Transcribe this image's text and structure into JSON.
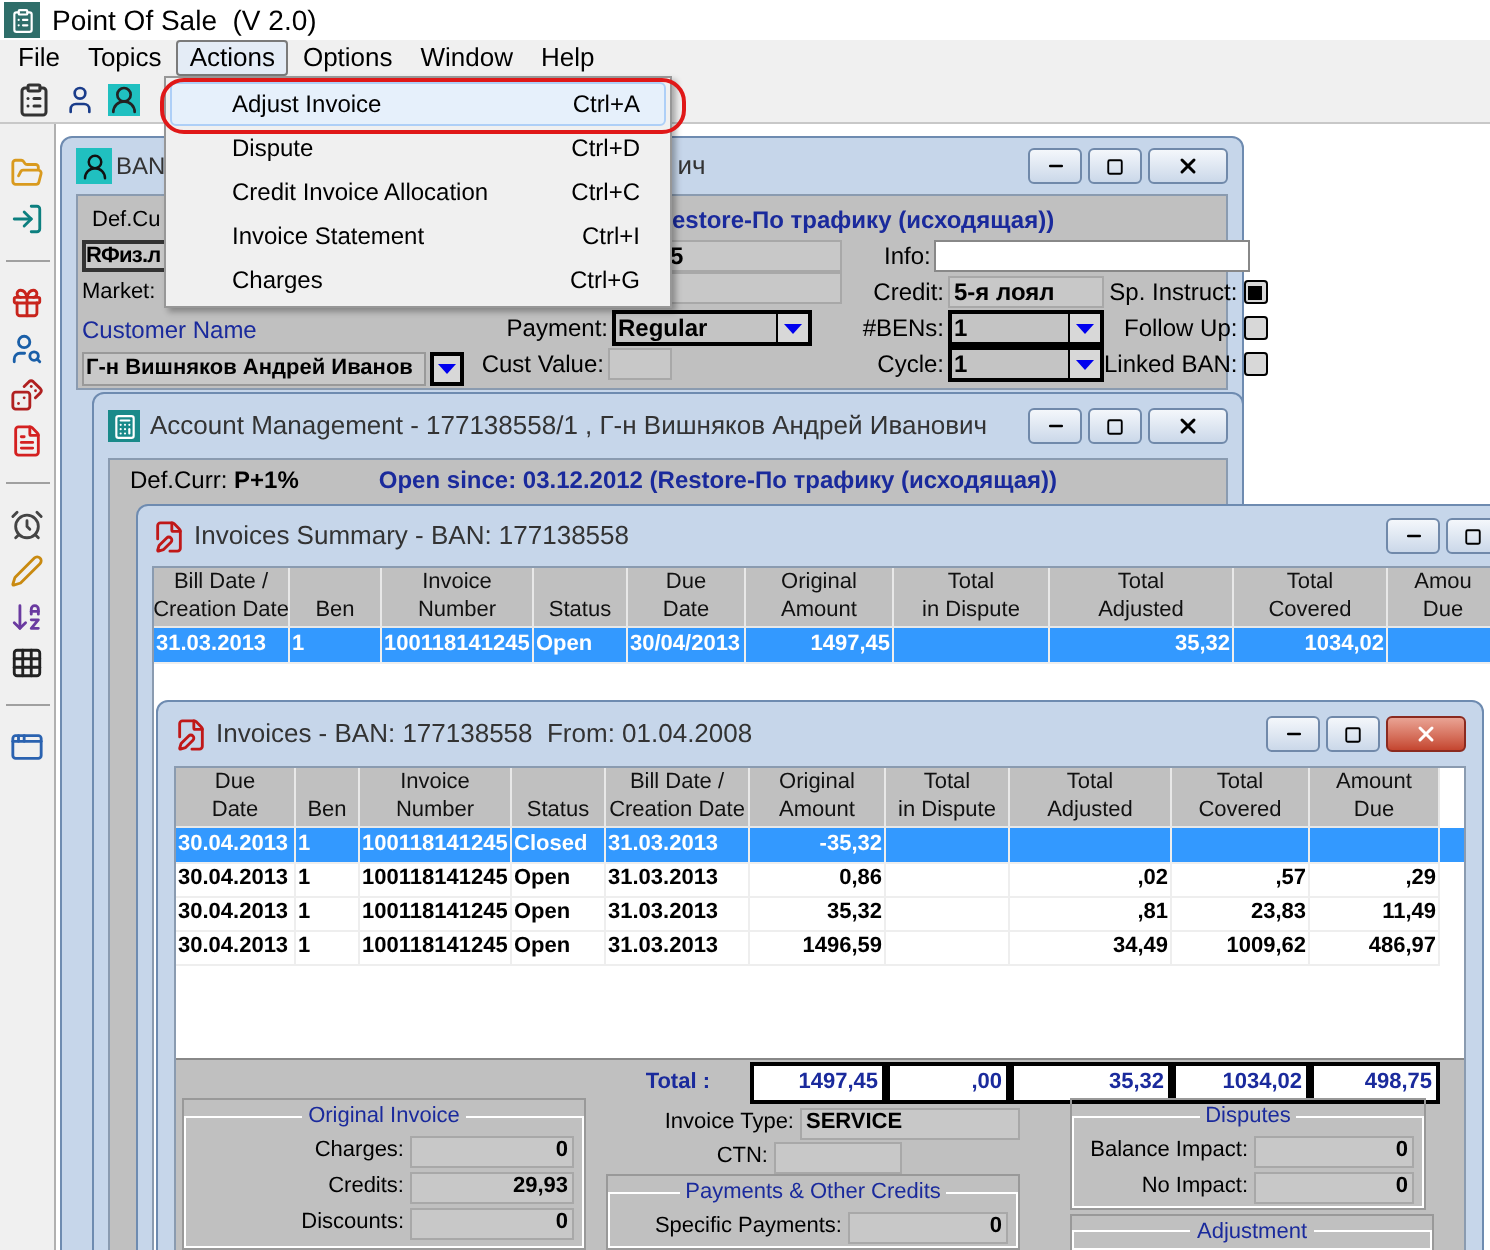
{
  "app": {
    "title": "Point Of Sale  (V 2.0)"
  },
  "menu": [
    {
      "label": "File",
      "selected": false
    },
    {
      "label": "Topics",
      "selected": false
    },
    {
      "label": "Actions",
      "selected": true
    },
    {
      "label": "Options",
      "selected": false
    },
    {
      "label": "Window",
      "selected": false
    },
    {
      "label": "Help",
      "selected": false
    }
  ],
  "actions_menu": [
    {
      "label": "Adjust Invoice",
      "shortcut": "Ctrl+A",
      "selected": true
    },
    {
      "label": "Dispute",
      "shortcut": "Ctrl+D",
      "selected": false
    },
    {
      "label": "Credit Invoice Allocation",
      "shortcut": "Ctrl+C",
      "selected": false
    },
    {
      "label": "Invoice Statement",
      "shortcut": "Ctrl+I",
      "selected": false
    },
    {
      "label": "Charges",
      "shortcut": "Ctrl+G",
      "selected": false
    }
  ],
  "ban_window": {
    "title_start": "BAN",
    "title_end": "ич",
    "def_curr_label": "Def.Cu",
    "account_type": "RФиз.л",
    "market_label": "Market:",
    "customer_name_label": "Customer Name",
    "customer_name": "Г-н Вишняков Андрей Иванов",
    "open_since": "estore-По трафику (исходящая))",
    "field_value": "5",
    "info_label": "Info:",
    "credit_label": "Credit:",
    "credit": "5-я лоял",
    "payment_label": "Payment:",
    "payment": "Regular",
    "cust_value_label": "Cust Value:",
    "bens_label": "#BENs:",
    "bens": "1",
    "cycle_label": "Cycle:",
    "cycle": "1",
    "checks": [
      {
        "label": "Sp. Instruct:",
        "checked": true
      },
      {
        "label": "Follow Up:",
        "checked": false
      },
      {
        "label": "Linked BAN:",
        "checked": false
      }
    ]
  },
  "account_window": {
    "title": "Account Management - 177138558/1 , Г-н Вишняков Андрей Иванович",
    "def_curr_label": "Def.Curr:",
    "def_curr": "P+1%",
    "open_since": "Open since: 03.12.2012 (Restore-По трафику (исходящая))"
  },
  "summary_window": {
    "title": "Invoices Summary - BAN: 177138558",
    "columns": [
      "Bill Date /\nCreation Date",
      "\nBen",
      "Invoice\nNumber",
      "\nStatus",
      "Due\nDate",
      "Original\nAmount",
      "Total\nin Dispute",
      "Total\nAdjusted",
      "Total\nCovered",
      "Amou\nDue"
    ],
    "rows": [
      {
        "selected": true,
        "cells": [
          "31.03.2013",
          "1",
          "100118141245",
          "Open",
          "30/04/2013",
          "1497,45",
          "",
          "35,32",
          "1034,02",
          ""
        ]
      }
    ]
  },
  "invoices_window": {
    "title": "Invoices - BAN: 177138558  From: 01.04.2008",
    "columns": [
      "Due\nDate",
      "\nBen",
      "Invoice\nNumber",
      "\nStatus",
      "Bill Date /\nCreation Date",
      "Original\nAmount",
      "Total\nin Dispute",
      "Total\nAdjusted",
      "Total\nCovered",
      "Amount\nDue"
    ],
    "rows": [
      {
        "selected": true,
        "cells": [
          "30.04.2013",
          "1",
          "100118141245",
          "Closed",
          "31.03.2013",
          "-35,32",
          "",
          "",
          "",
          ""
        ]
      },
      {
        "selected": false,
        "cells": [
          "30.04.2013",
          "1",
          "100118141245",
          "Open",
          "31.03.2013",
          "0,86",
          "",
          ",02",
          ",57",
          ",29"
        ]
      },
      {
        "selected": false,
        "cells": [
          "30.04.2013",
          "1",
          "100118141245",
          "Open",
          "31.03.2013",
          "35,32",
          "",
          ",81",
          "23,83",
          "11,49"
        ]
      },
      {
        "selected": false,
        "cells": [
          "30.04.2013",
          "1",
          "100118141245",
          "Open",
          "31.03.2013",
          "1496,59",
          "",
          "34,49",
          "1009,62",
          "486,97"
        ]
      }
    ],
    "total_label": "Total :",
    "totals": [
      "1497,45",
      ",00",
      "35,32",
      "1034,02",
      "498,75"
    ],
    "original_invoice": {
      "title": "Original Invoice",
      "rows": [
        {
          "label": "Charges:",
          "value": "0"
        },
        {
          "label": "Credits:",
          "value": "29,93"
        },
        {
          "label": "Discounts:",
          "value": "0"
        }
      ]
    },
    "invoice_type_label": "Invoice Type:",
    "invoice_type": "SERVICE",
    "ctn_label": "CTN:",
    "payments": {
      "title": "Payments & Other Credits",
      "rows": [
        {
          "label": "Specific Payments:",
          "value": "0"
        }
      ]
    },
    "disputes": {
      "title": "Disputes",
      "rows": [
        {
          "label": "Balance Impact:",
          "value": "0"
        },
        {
          "label": "No Impact:",
          "value": "0"
        }
      ]
    },
    "adjustment": {
      "title": "Adjustment"
    }
  }
}
